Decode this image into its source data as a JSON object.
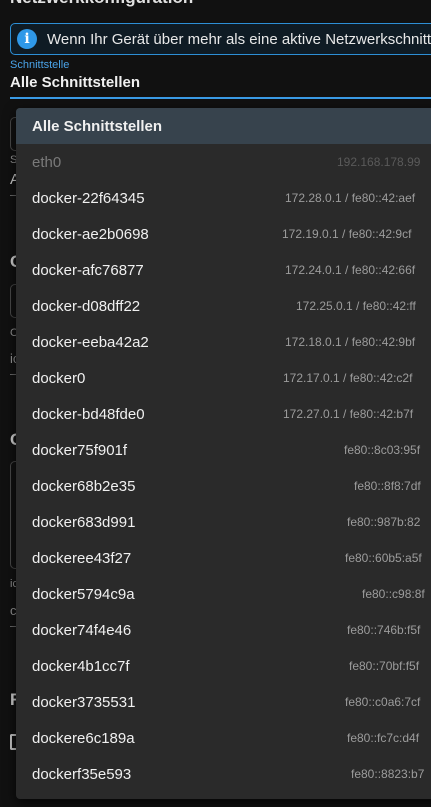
{
  "section": {
    "title": "Netzwerkkonfiguration"
  },
  "info_banner": {
    "icon": "info-icon",
    "text": "Wenn Ihr Gerät über mehr als eine aktive Netzwerkschnittstelle verfügt"
  },
  "interface_select": {
    "label": "Schnittstelle",
    "value": "Alle Schnittstellen",
    "accent_color": "#3a9be6"
  },
  "background_fragments": {
    "s1": "S",
    "a1": "A",
    "heading_c1": "C",
    "c2": "C",
    "ic1": "ic",
    "heading_c2": "C",
    "ic2": "ic",
    "c3": "c",
    "heading_r": "R"
  },
  "dropdown": {
    "items": [
      {
        "name": "Alle Schnittstellen",
        "address": "",
        "selected": true,
        "disabled": false
      },
      {
        "name": "eth0",
        "address": "192.168.178.99",
        "selected": false,
        "disabled": true
      },
      {
        "name": "docker-22f64345",
        "address": "172.28.0.1 / fe80::42:aef",
        "selected": false,
        "disabled": false
      },
      {
        "name": "docker-ae2b0698",
        "address": "172.19.0.1 / fe80::42:9cf",
        "selected": false,
        "disabled": false
      },
      {
        "name": "docker-afc76877",
        "address": "172.24.0.1 / fe80::42:66f",
        "selected": false,
        "disabled": false
      },
      {
        "name": "docker-d08dff22",
        "address": "172.25.0.1 / fe80::42:ff",
        "selected": false,
        "disabled": false
      },
      {
        "name": "docker-eeba42a2",
        "address": "172.18.0.1 / fe80::42:9bf",
        "selected": false,
        "disabled": false
      },
      {
        "name": "docker0",
        "address": "172.17.0.1 / fe80::42:c2f",
        "selected": false,
        "disabled": false
      },
      {
        "name": "docker-bd48fde0",
        "address": "172.27.0.1 / fe80::42:b7f",
        "selected": false,
        "disabled": false
      },
      {
        "name": "docker75f901f",
        "address": "fe80::8c03:95f",
        "selected": false,
        "disabled": false
      },
      {
        "name": "docker68b2e35",
        "address": "fe80::8f8:7df",
        "selected": false,
        "disabled": false
      },
      {
        "name": "docker683d991",
        "address": "fe80::987b:82",
        "selected": false,
        "disabled": false
      },
      {
        "name": "dockeree43f27",
        "address": "fe80::60b5:a5f",
        "selected": false,
        "disabled": false
      },
      {
        "name": "docker5794c9a",
        "address": "fe80::c98:8f",
        "selected": false,
        "disabled": false
      },
      {
        "name": "docker74f4e46",
        "address": "fe80::746b:f5f",
        "selected": false,
        "disabled": false
      },
      {
        "name": "docker4b1cc7f",
        "address": "fe80::70bf:f5f",
        "selected": false,
        "disabled": false
      },
      {
        "name": "docker3735531",
        "address": "fe80::c0a6:7cf",
        "selected": false,
        "disabled": false
      },
      {
        "name": "dockere6c189a",
        "address": "fe80::fc7c:d4f",
        "selected": false,
        "disabled": false
      },
      {
        "name": "dockerf35e593",
        "address": "fe80::8823:b7",
        "selected": false,
        "disabled": false
      }
    ]
  }
}
